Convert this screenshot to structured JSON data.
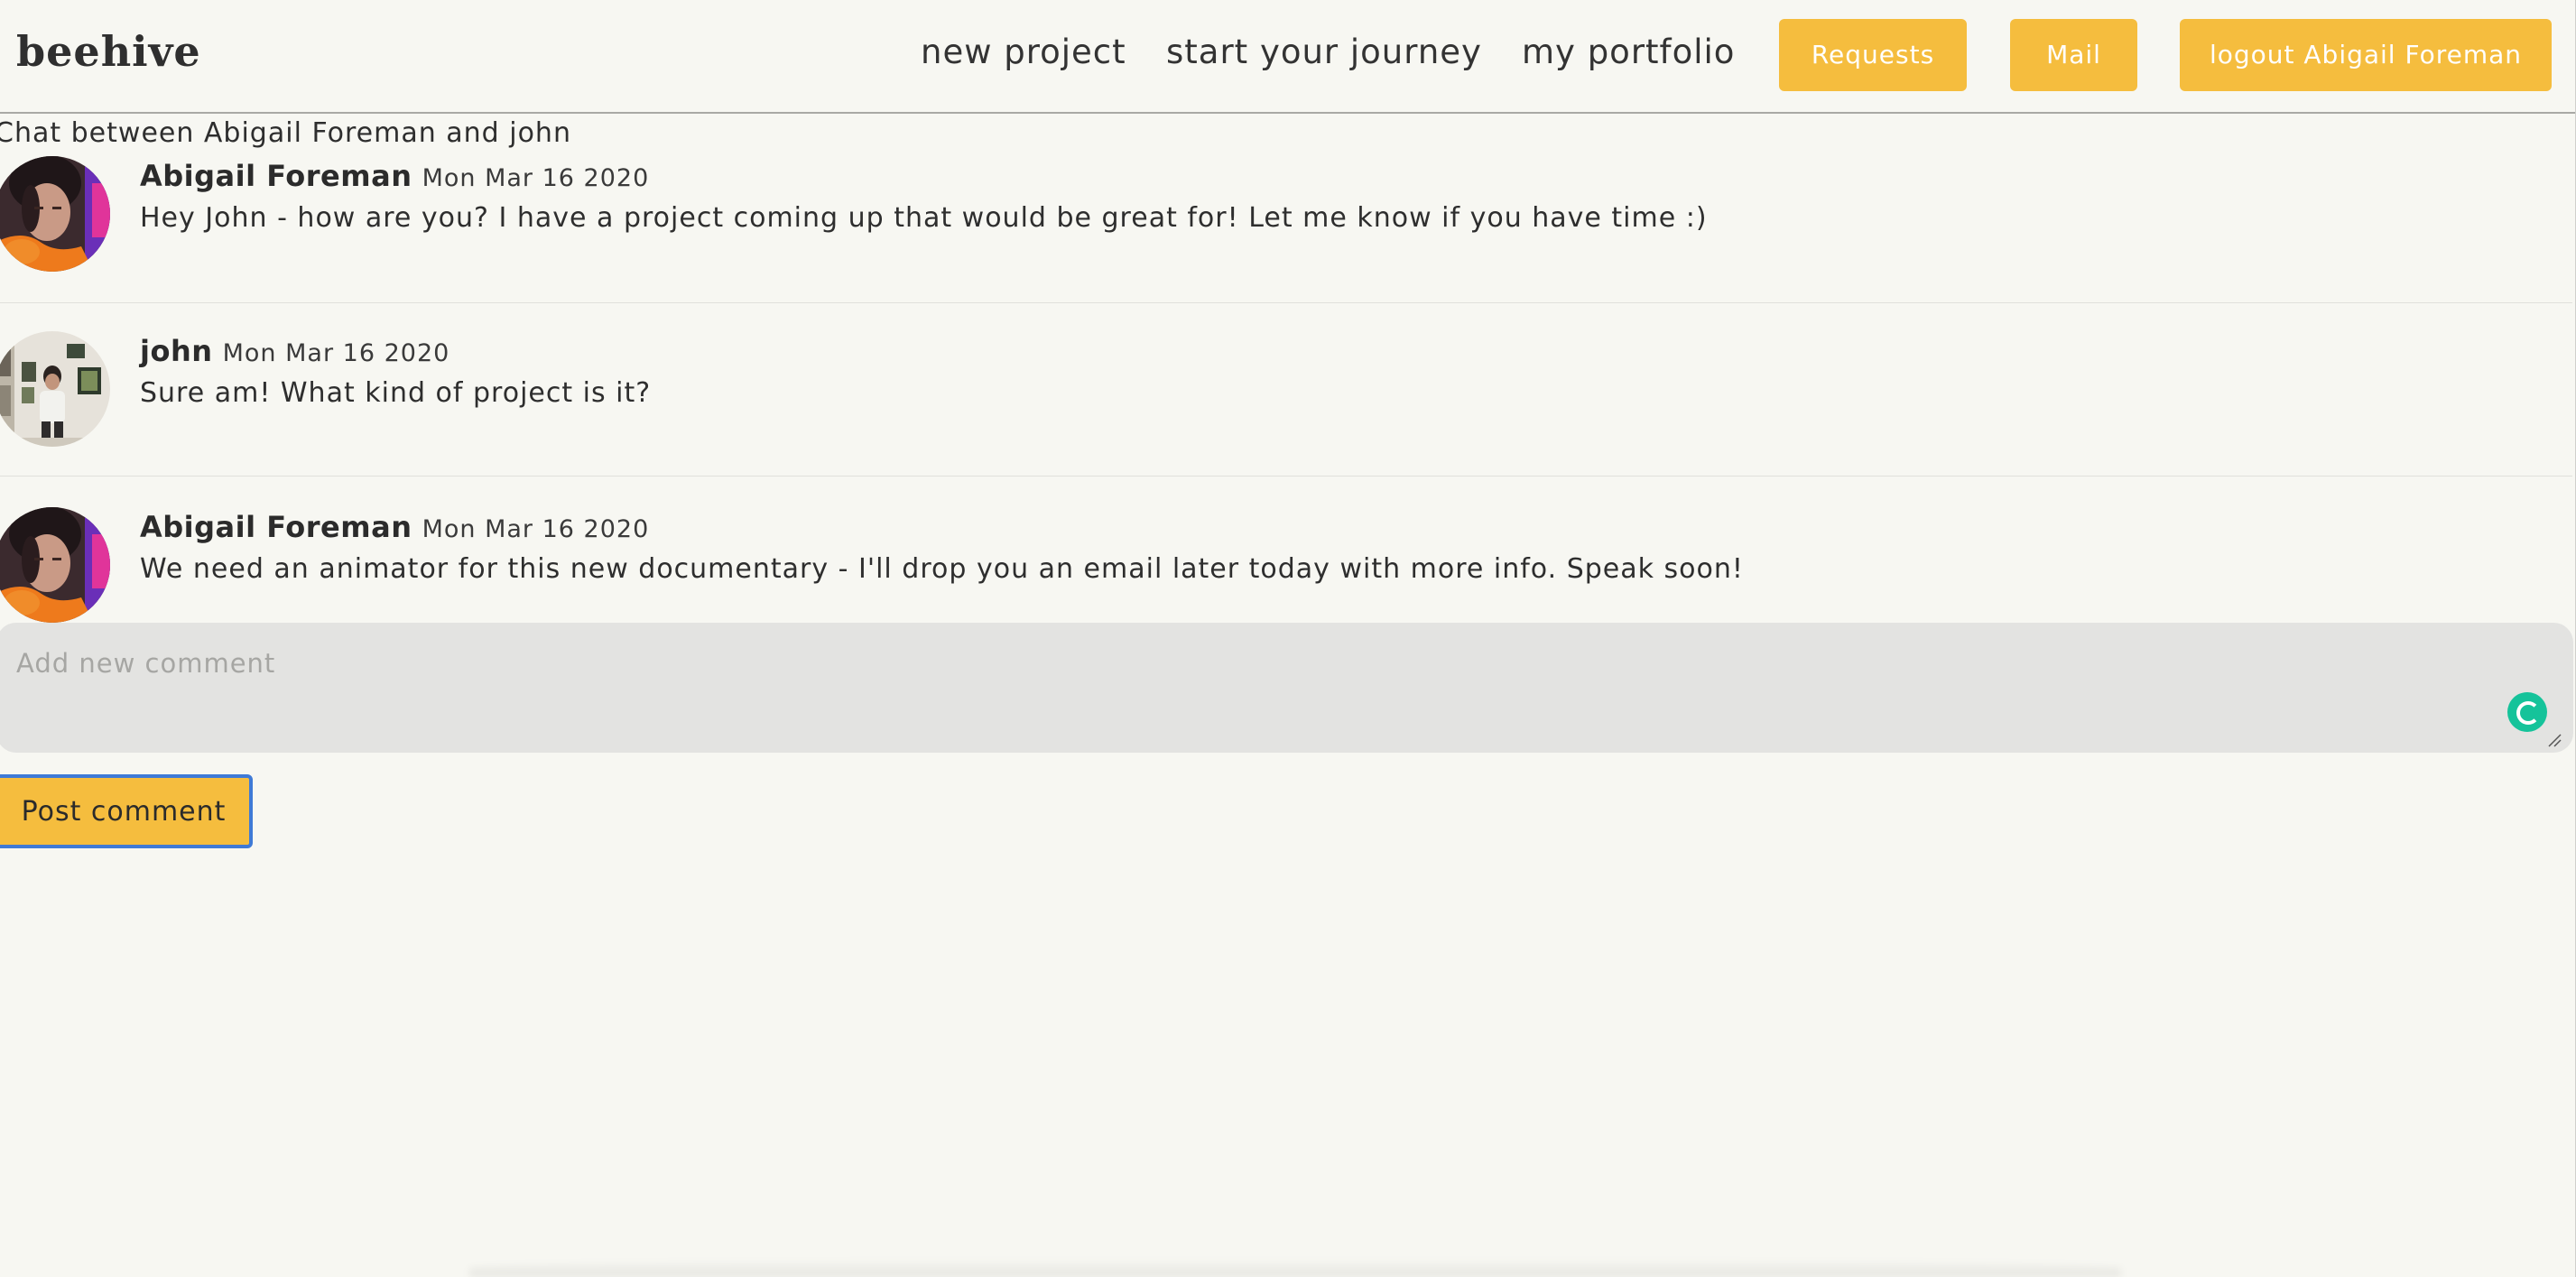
{
  "header": {
    "logo": "beehive",
    "nav_links": {
      "new_project": "new project",
      "start_journey": "start your journey",
      "portfolio": "my portfolio"
    },
    "buttons": {
      "requests": "Requests",
      "mail": "Mail",
      "logout": "logout Abigail Foreman"
    },
    "accent_color": "#f5bd3e"
  },
  "chat": {
    "title": "Chat between Abigail Foreman and john",
    "messages": [
      {
        "author": "Abigail Foreman",
        "date": "Mon Mar 16 2020",
        "text": "Hey John - how are you? I have a project coming up that would be great for! Let me know if you have time :)",
        "avatar": "abigail-avatar"
      },
      {
        "author": "john",
        "date": "Mon Mar 16 2020",
        "text": "Sure am! What kind of project is it?",
        "avatar": "john-avatar"
      },
      {
        "author": "Abigail Foreman",
        "date": "Mon Mar 16 2020",
        "text": "We need an animator for this new documentary - I'll drop you an email later today with more info. Speak soon!",
        "avatar": "abigail-avatar"
      }
    ]
  },
  "comment": {
    "placeholder": "Add new comment",
    "value": "",
    "post_label": "Post comment"
  }
}
